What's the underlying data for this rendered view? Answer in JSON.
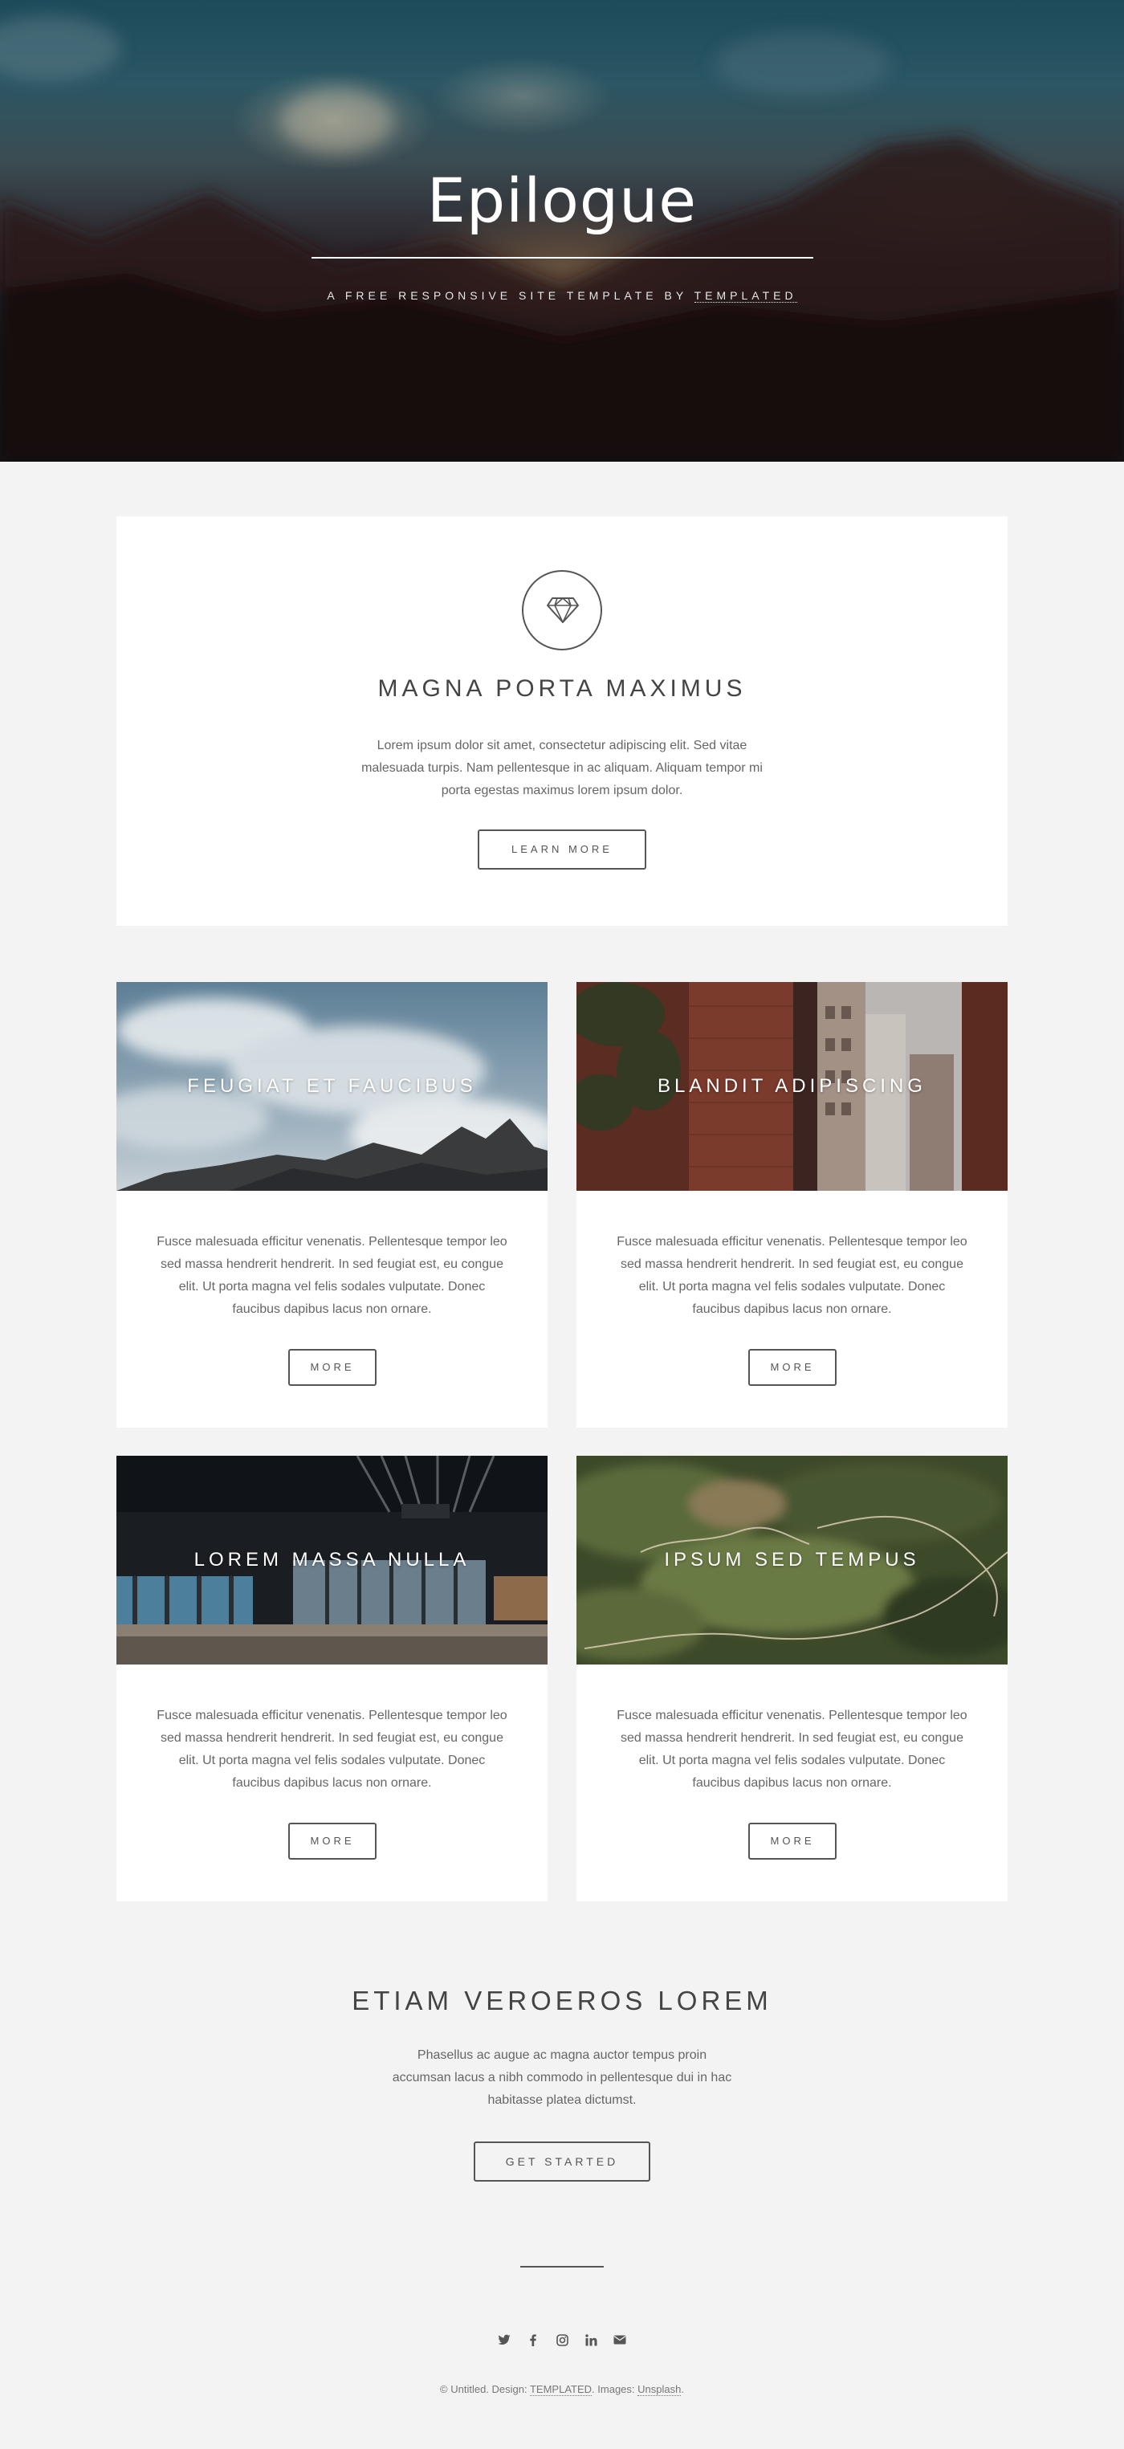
{
  "hero": {
    "title": "Epilogue",
    "tagline_prefix": "A free responsive site template by",
    "tagline_link": "TEMPLATED"
  },
  "feature": {
    "icon": "diamond-icon",
    "title": "Magna Porta Maximus",
    "text": "Lorem ipsum dolor sit amet, consectetur adipiscing elit. Sed vitae malesuada turpis. Nam pellentesque in ac aliquam. Aliquam tempor mi porta egestas maximus lorem ipsum dolor.",
    "button": "Learn More"
  },
  "cards": [
    {
      "title": "Feugiat et Faucibus",
      "text": "Fusce malesuada efficitur venenatis. Pellentesque tempor leo sed massa hendrerit hendrerit. In sed feugiat est, eu congue elit. Ut porta magna vel felis sodales vulputate. Donec faucibus dapibus lacus non ornare.",
      "button": "More"
    },
    {
      "title": "Blandit Adipiscing",
      "text": "Fusce malesuada efficitur venenatis. Pellentesque tempor leo sed massa hendrerit hendrerit. In sed feugiat est, eu congue elit. Ut porta magna vel felis sodales vulputate. Donec faucibus dapibus lacus non ornare.",
      "button": "More"
    },
    {
      "title": "Lorem Massa Nulla",
      "text": "Fusce malesuada efficitur venenatis. Pellentesque tempor leo sed massa hendrerit hendrerit. In sed feugiat est, eu congue elit. Ut porta magna vel felis sodales vulputate. Donec faucibus dapibus lacus non ornare.",
      "button": "More"
    },
    {
      "title": "Ipsum Sed Tempus",
      "text": "Fusce malesuada efficitur venenatis. Pellentesque tempor leo sed massa hendrerit hendrerit. In sed feugiat est, eu congue elit. Ut porta magna vel felis sodales vulputate. Donec faucibus dapibus lacus non ornare.",
      "button": "More"
    }
  ],
  "cta": {
    "title": "Etiam Veroeros Lorem",
    "text": "Phasellus ac augue ac magna auctor tempus proin accumsan lacus a nibh commodo in pellentesque dui in hac habitasse platea dictumst.",
    "button": "Get Started"
  },
  "footer": {
    "social_icons": [
      "twitter-icon",
      "facebook-icon",
      "instagram-icon",
      "linkedin-icon",
      "envelope-icon"
    ],
    "copyright_prefix": "© Untitled. Design: ",
    "design_link": "TEMPLATED",
    "images_prefix": ". Images: ",
    "images_link": "Unsplash",
    "copyright_suffix": "."
  },
  "colors": {
    "page_bg": "#f3f3f3",
    "panel_bg": "#ffffff",
    "text": "#555555",
    "heading": "#444444"
  }
}
